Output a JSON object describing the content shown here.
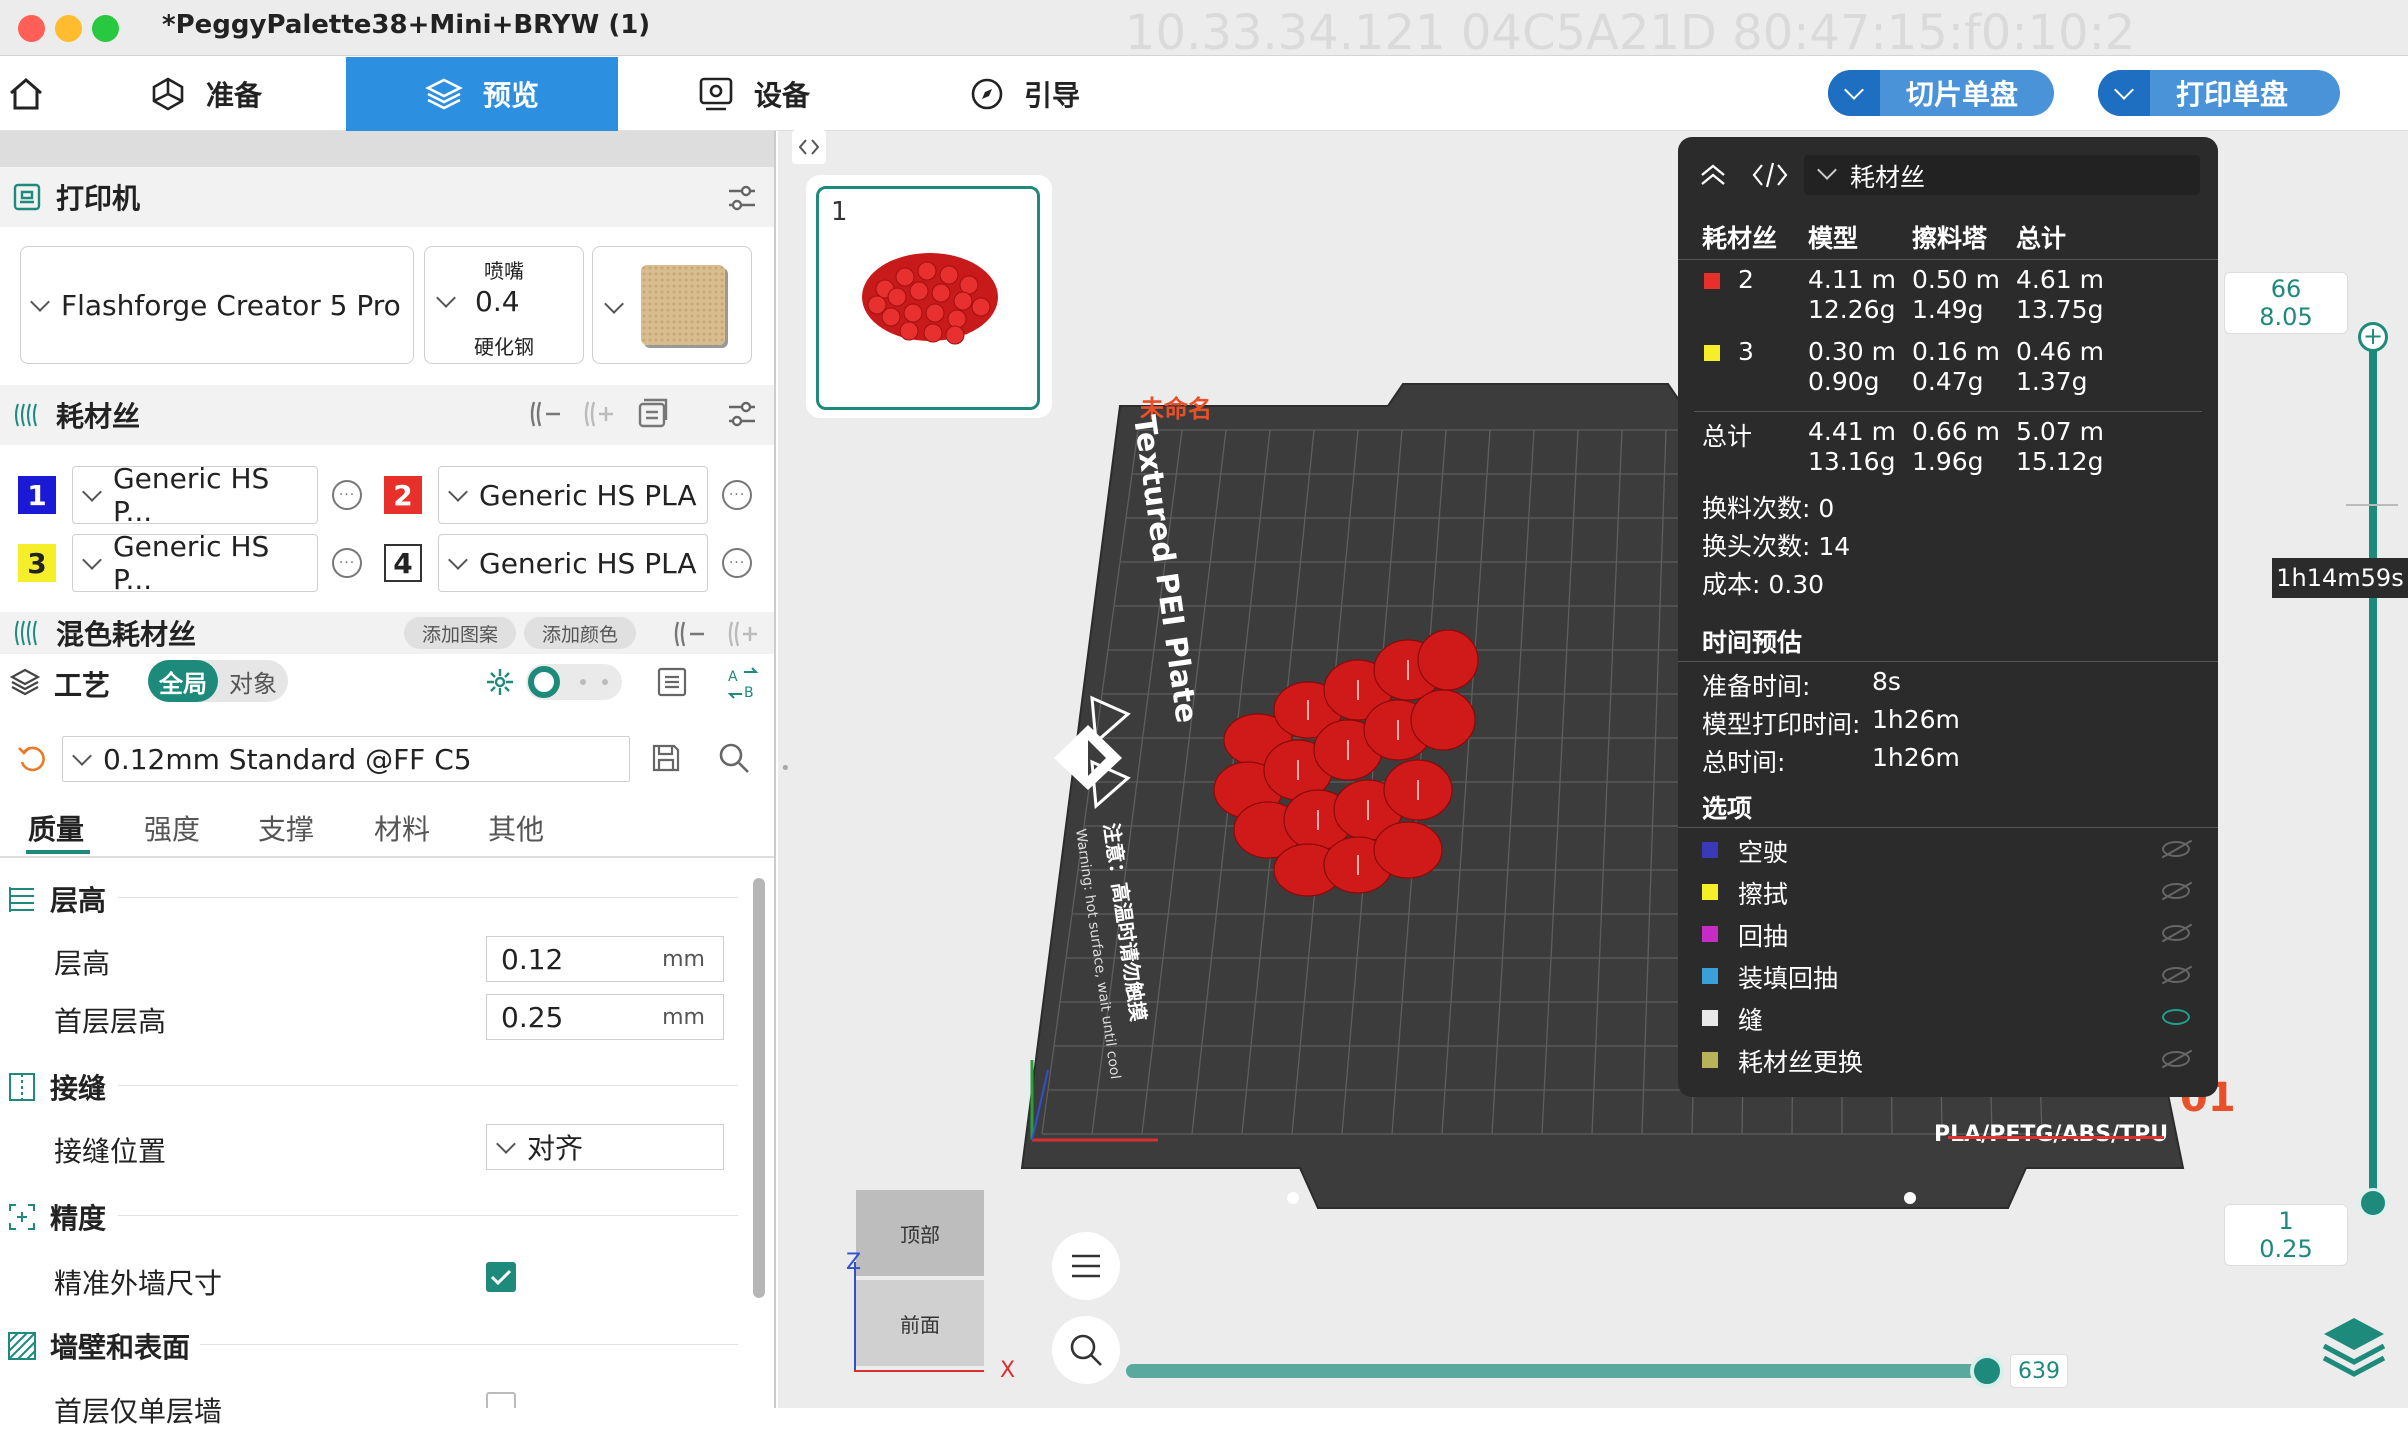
{
  "window": {
    "title": "*PeggyPalette38+Mini+BRYW (1)",
    "ghost_text": "10.33.34.121  04C5A21D  80:47:15:f0:10:2"
  },
  "nav": {
    "home": "home",
    "prepare": "准备",
    "preview": "预览",
    "device": "设备",
    "guide": "引导",
    "slice_btn": "切片单盘",
    "print_btn": "打印单盘"
  },
  "printer": {
    "section_title": "打印机",
    "name": "Flashforge Creator 5 Pro",
    "nozzle_label": "喷嘴",
    "nozzle_size": "0.4",
    "nozzle_material": "硬化钢"
  },
  "filament": {
    "section_title": "耗材丝",
    "slots": [
      {
        "num": "1",
        "name": "Generic HS P...",
        "color": "#1a1ad6",
        "text_color": "#ffffff"
      },
      {
        "num": "2",
        "name": "Generic HS PLA",
        "color": "#e8302a",
        "text_color": "#ffffff"
      },
      {
        "num": "3",
        "name": "Generic HS P...",
        "color": "#f5ef2a",
        "text_color": "#222222"
      },
      {
        "num": "4",
        "name": "Generic HS PLA",
        "color": "#ffffff",
        "text_color": "#222222"
      }
    ]
  },
  "mix": {
    "title": "混色耗材丝",
    "add_pattern": "添加图案",
    "add_color": "添加颜色"
  },
  "process": {
    "title": "工艺",
    "global": "全局",
    "object": "对象",
    "preset": "0.12mm Standard @FF C5",
    "tabs": [
      "质量",
      "强度",
      "支撑",
      "材料",
      "其他"
    ],
    "groups": {
      "layer_height": "层高",
      "seam": "接缝",
      "precision": "精度",
      "wall": "墙壁和表面"
    },
    "params": {
      "layer_height_label": "层高",
      "layer_height_value": "0.12",
      "first_layer_label": "首层层高",
      "first_layer_value": "0.25",
      "unit": "mm",
      "seam_pos_label": "接缝位置",
      "seam_pos_value": "对齐",
      "precise_wall_label": "精准外墙尺寸",
      "first_layer_single_label": "首层仅单层墙"
    }
  },
  "plate": {
    "thumb_number": "1",
    "bed_label": "Textured PEI Plate",
    "unnamed": "未命名",
    "materials": "PLA/PETG/ABS/TPU",
    "warning": "注意：高温时请勿触摸",
    "warning_en": "Warning: hot surface, wait until cool",
    "plate_num": "01"
  },
  "overlay": {
    "dropdown": "耗材丝",
    "headers": [
      "耗材丝",
      "模型",
      "擦料塔",
      "总计"
    ],
    "rows": [
      {
        "id": "2",
        "color": "#e8302a",
        "model_m": "4.11 m",
        "model_g": "12.26g",
        "tower_m": "0.50 m",
        "tower_g": "1.49g",
        "total_m": "4.61 m",
        "total_g": "13.75g"
      },
      {
        "id": "3",
        "color": "#f5ef2a",
        "model_m": "0.30 m",
        "model_g": "0.90g",
        "tower_m": "0.16 m",
        "tower_g": "0.47g",
        "total_m": "0.46 m",
        "total_g": "1.37g"
      }
    ],
    "total": {
      "label": "总计",
      "model_m": "4.41 m",
      "model_g": "13.16g",
      "tower_m": "0.66 m",
      "tower_g": "1.96g",
      "total_m": "5.07 m",
      "total_g": "15.12g"
    },
    "changes": "换料次数:  0",
    "head_changes": "换头次数:  14",
    "cost": "成本:  0.30",
    "time_title": "时间预估",
    "prep_label": "准备时间:",
    "prep_value": "8s",
    "model_time_label": "模型打印时间:",
    "model_time_value": "1h26m",
    "total_time_label": "总时间:",
    "total_time_value": "1h26m",
    "options_title": "选项",
    "options": [
      {
        "label": "空驶",
        "color": "#3a3ab8",
        "visible": false
      },
      {
        "label": "擦拭",
        "color": "#f5ef2a",
        "visible": false
      },
      {
        "label": "回抽",
        "color": "#c42cc4",
        "visible": false
      },
      {
        "label": "装填回抽",
        "color": "#3aa0d8",
        "visible": false
      },
      {
        "label": "缝",
        "color": "#e8e8e8",
        "visible": true
      },
      {
        "label": "耗材丝更换",
        "color": "#b8b25a",
        "visible": false
      }
    ]
  },
  "slider": {
    "top_layer": "66",
    "top_height": "8.05",
    "bottom_layer": "1",
    "bottom_height": "0.25",
    "time_tip": "1h14m59s",
    "h_value": "639"
  },
  "viewcube": {
    "top": "顶部",
    "front": "前面",
    "z": "Z",
    "x": "X"
  }
}
